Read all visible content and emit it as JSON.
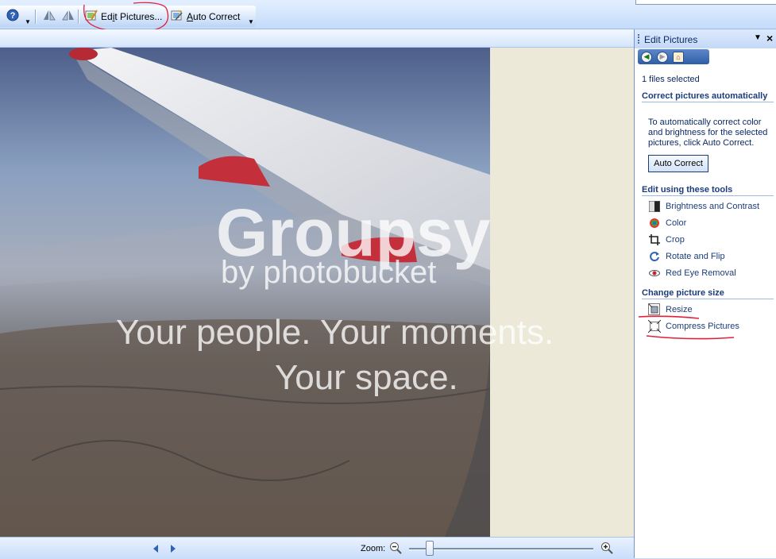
{
  "toolbar": {
    "edit_pictures_label": "Edit Pictures...",
    "auto_correct_label": "Auto Correct",
    "icons": [
      "help-icon",
      "rotate-left-icon",
      "rotate-right-icon",
      "edit-pictures-icon",
      "auto-correct-icon"
    ]
  },
  "viewer": {
    "watermark_brand": "Groupsy",
    "watermark_by": "by photobucket",
    "watermark_line1": "Your people. Your moments.",
    "watermark_line2": "Your space."
  },
  "status": {
    "zoom_label": "Zoom:",
    "zoom_level": 0.12
  },
  "taskpane": {
    "title": "Edit Pictures",
    "files_selected": "1 files selected",
    "sections": {
      "correct_auto": "Correct pictures automatically",
      "correct_desc": "To automatically correct color and brightness for the selected pictures, click Auto Correct.",
      "auto_correct_button": "Auto Correct",
      "edit_tools": "Edit using these tools",
      "change_size": "Change picture size"
    },
    "tools": [
      {
        "label": "Brightness and Contrast",
        "icon": "brightness-icon"
      },
      {
        "label": "Color",
        "icon": "color-icon"
      },
      {
        "label": "Crop",
        "icon": "crop-icon"
      },
      {
        "label": "Rotate and Flip",
        "icon": "rotate-flip-icon"
      },
      {
        "label": "Red Eye Removal",
        "icon": "red-eye-icon"
      }
    ],
    "size_tools": [
      {
        "label": "Resize",
        "icon": "resize-icon"
      },
      {
        "label": "Compress Pictures",
        "icon": "compress-icon"
      }
    ]
  },
  "colors": {
    "panel_text": "#1b3d7a",
    "annotation_red": "#e0203a",
    "chrome_blue": "#c3daf9"
  }
}
